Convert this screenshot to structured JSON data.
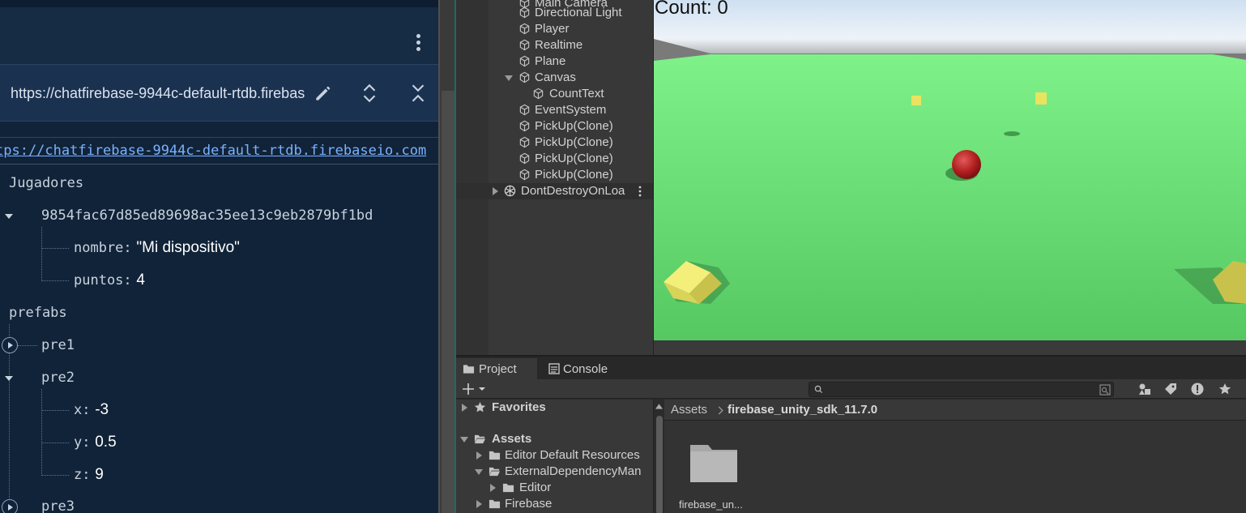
{
  "firebase": {
    "db_url_short": "https://chatfirebase-9944c-default-rtdb.firebas",
    "db_url_full": "tps://chatfirebase-9944c-default-rtdb.firebaseio.com",
    "tree": {
      "jugadores": "Jugadores",
      "player_id": "9854fac67d85ed89698ac35ee13c9eb2879bf1bd",
      "nombre_key": "nombre:",
      "nombre_val": "\"Mi dispositivo\"",
      "puntos_key": "puntos:",
      "puntos_val": "4",
      "prefabs": "prefabs",
      "pre1": "pre1",
      "pre2": "pre2",
      "x_key": "x:",
      "x_val": "-3",
      "y_key": "y:",
      "y_val": "0.5",
      "z_key": "z:",
      "z_val": "9",
      "pre3": "pre3"
    }
  },
  "hierarchy": {
    "items": [
      "Main Camera",
      "Directional Light",
      "Player",
      "Realtime",
      "Plane",
      "Canvas",
      "CountText",
      "EventSystem",
      "PickUp(Clone)",
      "PickUp(Clone)",
      "PickUp(Clone)",
      "PickUp(Clone)"
    ],
    "dont_destroy": "DontDestroyOnLoa"
  },
  "game": {
    "count_text": "Count: 0",
    "colors": {
      "ground": "#5bcf68",
      "sky": "#d8e6f4",
      "ball": "#b01e1e",
      "pickup": "#e6e060"
    }
  },
  "project": {
    "tabs": {
      "project": "Project",
      "console": "Console"
    },
    "tree": {
      "favorites": "Favorites",
      "assets": "Assets",
      "editor_default": "Editor Default Resources",
      "external_dep": "ExternalDependencyMan",
      "editor": "Editor",
      "firebase": "Firebase"
    },
    "breadcrumb": {
      "root": "Assets",
      "current": "firebase_unity_sdk_11.7.0"
    },
    "asset_label": "firebase_un..."
  }
}
